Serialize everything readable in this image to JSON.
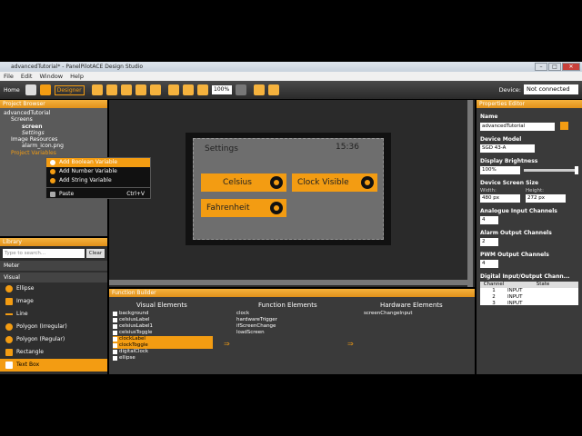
{
  "window": {
    "title": "advancedTutorial* - PanelPilotACE Design Studio"
  },
  "menu": [
    "File",
    "Edit",
    "Window",
    "Help"
  ],
  "toolbar": {
    "home": "Home",
    "designer": "Designer",
    "zoom": "100%",
    "device_label": "Device:",
    "device_value": "Not connected"
  },
  "project_browser": {
    "title": "Project Browser",
    "tree": [
      "advancedTutorial",
      "Screens",
      "screen",
      "Settings",
      "Image Resources",
      "alarm_icon.png",
      "Project Variables"
    ]
  },
  "context_menu": {
    "items": [
      "Add Boolean Variable",
      "Add Number Variable",
      "Add String Variable"
    ],
    "paste": "Paste",
    "paste_shortcut": "Ctrl+V"
  },
  "library": {
    "title": "Library",
    "search_placeholder": "Type to search...",
    "clear": "Clear",
    "cat_meter": "Meter",
    "cat_visual": "Visual",
    "items": [
      "Ellipse",
      "Image",
      "Line",
      "Polygon (Irregular)",
      "Polygon (Regular)",
      "Rectangle",
      "Text Box"
    ]
  },
  "screen": {
    "title": "Settings",
    "time": "15:36",
    "btn_celsius": "Celsius",
    "btn_fahrenheit": "Fahrenheit",
    "btn_clock": "Clock Visible"
  },
  "function_builder": {
    "title": "Function Builder",
    "col_visual": "Visual Elements",
    "col_function": "Function Elements",
    "col_hardware": "Hardware Elements",
    "visual": [
      "background",
      "celsiusLabel",
      "celsiusLabel1",
      "celsiusToggle",
      "clockLabel",
      "clockToggle",
      "digitalClock",
      "ellipse"
    ],
    "function": [
      "clock",
      "hardwareTrigger",
      "ifScreenChange",
      "loadScreen"
    ],
    "hardware": [
      "screenChangeInput"
    ]
  },
  "properties": {
    "title": "Properties Editor",
    "name_label": "Name",
    "name_value": "advancedTutorial",
    "model_label": "Device Model",
    "model_value": "SGD 43-A",
    "brightness_label": "Display Brightness",
    "brightness_value": "100%",
    "screen_size_label": "Device Screen Size",
    "width_label": "Width:",
    "height_label": "Height:",
    "width_value": "480 px",
    "height_value": "272 px",
    "analogue_label": "Analogue Input Channels",
    "analogue_value": "4",
    "alarm_label": "Alarm Output Channels",
    "alarm_value": "2",
    "pwm_label": "PWM Output Channels",
    "pwm_value": "4",
    "dio_label": "Digital Input/Output Chann...",
    "dio_col_channel": "Channel",
    "dio_col_state": "State",
    "dio_rows": [
      [
        "1",
        "INPUT"
      ],
      [
        "2",
        "INPUT"
      ],
      [
        "3",
        "INPUT"
      ]
    ]
  },
  "colors": {
    "accent": "#f39c12",
    "panel": "#3a3a3a",
    "canvas": "#2a2a2a"
  }
}
